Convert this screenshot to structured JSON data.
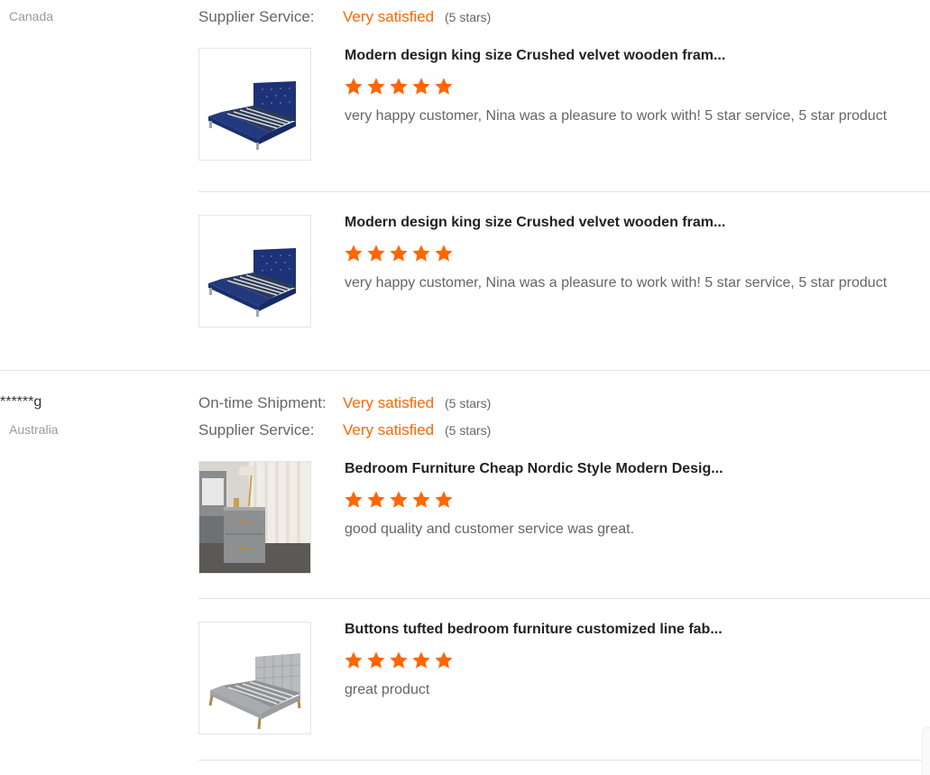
{
  "colors": {
    "accent": "#ff6600",
    "star": "#ff6600",
    "divider": "#e3e3e3"
  },
  "reviewer1": {
    "country": "Canada",
    "supplier_service": {
      "label": "Supplier Service:",
      "value": "Very satisfied",
      "stars": "(5 stars)"
    },
    "products": [
      {
        "title": "Modern design king size Crushed velvet wooden fram...",
        "rating": 5,
        "comment": "very happy customer, Nina was a pleasure to work with! 5 star service, 5 star product"
      },
      {
        "title": "Modern design king size Crushed velvet wooden fram...",
        "rating": 5,
        "comment": "very happy customer, Nina was a pleasure to work with! 5 star service, 5 star product"
      }
    ]
  },
  "reviewer2": {
    "name": "******g",
    "country": "Australia",
    "on_time_shipment": {
      "label": "On-time Shipment:",
      "value": "Very satisfied",
      "stars": "(5 stars)"
    },
    "supplier_service": {
      "label": "Supplier Service:",
      "value": "Very satisfied",
      "stars": "(5 stars)"
    },
    "products": [
      {
        "title": "Bedroom Furniture Cheap Nordic Style Modern Desig...",
        "rating": 5,
        "comment": "good quality and customer service was great."
      },
      {
        "title": "Buttons tufted bedroom furniture customized line fab...",
        "rating": 5,
        "comment": "great product"
      }
    ]
  }
}
